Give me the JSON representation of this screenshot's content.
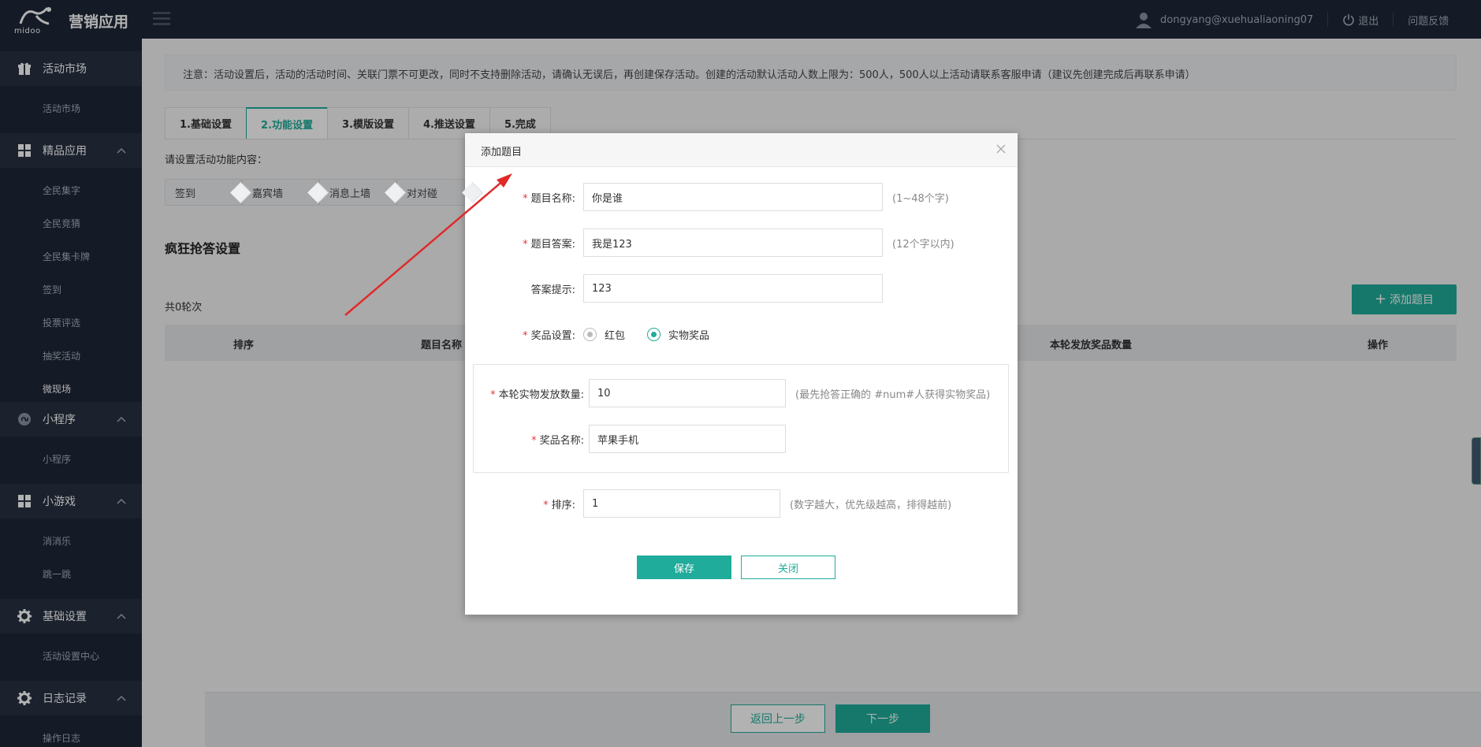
{
  "header": {
    "logo_text": "midoo",
    "app_title": "营销应用",
    "user": "dongyang@xuehualiaoning07",
    "logout": "退出",
    "feedback": "问题反馈"
  },
  "sidebar": {
    "groups": [
      {
        "label": "活动市场",
        "icon": "gift-icon",
        "items": [
          "活动市场"
        ]
      },
      {
        "label": "精品应用",
        "icon": "grid-icon",
        "items": [
          "全民集字",
          "全民竞猜",
          "全民集卡牌",
          "签到",
          "投票评选",
          "抽奖活动",
          "微现场"
        ]
      },
      {
        "label": "小程序",
        "icon": "mini-program-icon",
        "items": [
          "小程序"
        ]
      },
      {
        "label": "小游戏",
        "icon": "grid-icon",
        "items": [
          "消消乐",
          "跳一跳"
        ]
      },
      {
        "label": "基础设置",
        "icon": "gear-icon",
        "items": [
          "活动设置中心"
        ]
      },
      {
        "label": "日志记录",
        "icon": "gear-icon",
        "items": [
          "操作日志"
        ]
      }
    ]
  },
  "main": {
    "notice": "注意：活动设置后，活动的活动时间、关联门票不可更改，同时不支持删除活动，请确认无误后，再创建保存活动。创建的活动默认活动人数上限为：500人，500人以上活动请联系客服申请（建议先创建完成后再联系申请）",
    "tabs": [
      "1.基础设置",
      "2.功能设置",
      "3.模版设置",
      "4.推送设置",
      "5.完成"
    ],
    "active_tab": "2.功能设置",
    "func_prompt": "请设置活动功能内容：",
    "steps": [
      "签到",
      "嘉宾墙",
      "消息上墙",
      "对对碰"
    ],
    "section_title": "疯狂抢答设置",
    "rounds": "共0轮次",
    "add_question_button": "添加题目",
    "table_headers": [
      "排序",
      "题目名称",
      "本轮发放奖品数量",
      "操作"
    ],
    "prev_button": "返回上一步",
    "next_button": "下一步"
  },
  "modal": {
    "title": "添加题目",
    "fields": {
      "question_name": {
        "label": "题目名称:",
        "value": "你是谁",
        "hint": "(1~48个字)"
      },
      "question_answer": {
        "label": "题目答案:",
        "value": "我是123",
        "hint": "(12个字以内)"
      },
      "answer_hint": {
        "label": "答案提示:",
        "value": "123"
      },
      "prize_setting": {
        "label": "奖品设置:",
        "options": [
          "红包",
          "实物奖品"
        ],
        "selected": "实物奖品"
      },
      "prize_quantity": {
        "label": "本轮实物发放数量:",
        "value": "10",
        "hint": "(最先抢答正确的 #num#人获得实物奖品)"
      },
      "prize_name": {
        "label": "奖品名称:",
        "value": "苹果手机"
      },
      "sort": {
        "label": "排序:",
        "value": "1",
        "hint": "(数字越大，优先级越高，排得越前)"
      }
    },
    "save_button": "保存",
    "close_button": "关闭"
  },
  "colors": {
    "accent": "#1fac9a",
    "sidebar_bg": "#1d2637",
    "required": "#e4393c",
    "annotation_arrow": "#e02a2a"
  }
}
